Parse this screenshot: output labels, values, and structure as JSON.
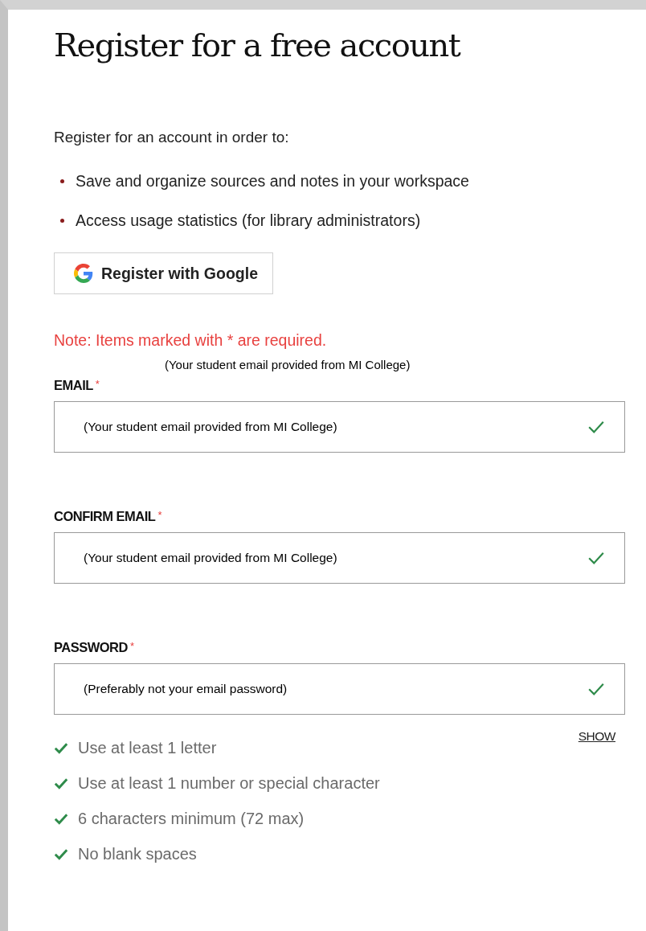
{
  "title": "Register for a free account",
  "intro": "Register for an account in order to:",
  "benefits": [
    "Save and organize sources and notes in your workspace",
    "Access usage statistics (for library administrators)"
  ],
  "google_button": {
    "label": "Register with Google"
  },
  "note": "Note: Items marked with * are required.",
  "annotation": "(Your student email provided from MI College)",
  "fields": [
    {
      "label": "EMAIL",
      "required_mark": "*",
      "value": "(Your student email provided from MI College)",
      "valid": true
    },
    {
      "label": "CONFIRM EMAIL",
      "required_mark": "*",
      "value": "(Your student email provided from MI College)",
      "valid": true
    },
    {
      "label": "PASSWORD",
      "required_mark": "*",
      "value": "(Preferably not your email password)",
      "valid": true
    }
  ],
  "show_link": "SHOW",
  "rules": [
    {
      "text": "Use at least 1 letter",
      "met": true
    },
    {
      "text": "Use at least 1 number or special character",
      "met": true
    },
    {
      "text": "6 characters minimum (72 max)",
      "met": true
    },
    {
      "text": "No blank spaces",
      "met": true
    }
  ]
}
